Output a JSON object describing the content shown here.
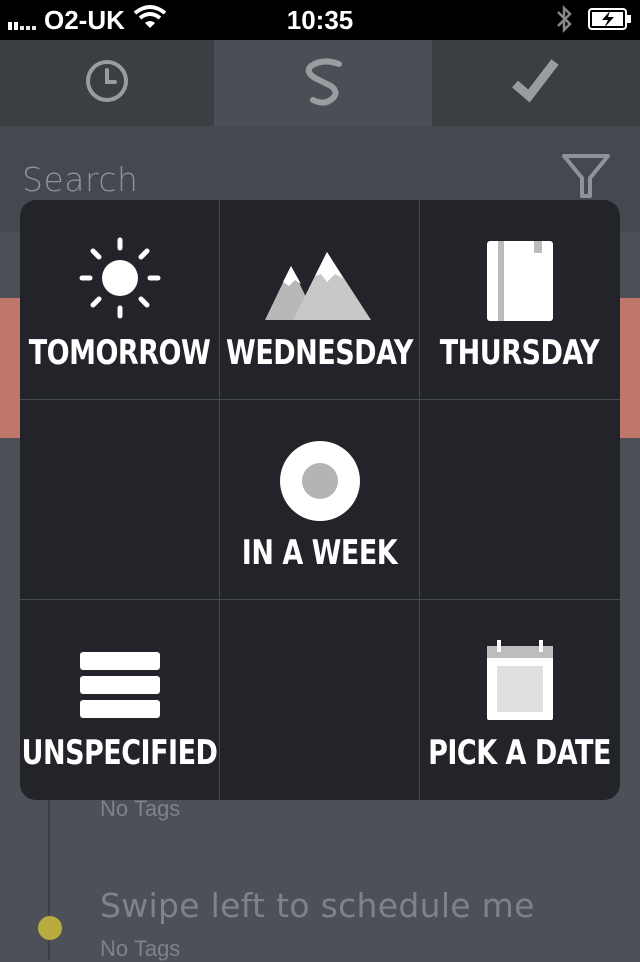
{
  "status_bar": {
    "carrier": "O2-UK",
    "time": "10:35",
    "signal_icon": "signal-bars-icon",
    "wifi_icon": "wifi-icon",
    "bluetooth_icon": "bluetooth-icon",
    "battery_icon": "battery-charging-icon"
  },
  "tabs": [
    {
      "icon": "clock-icon",
      "selected": false
    },
    {
      "icon": "swipe-s-icon",
      "selected": true
    },
    {
      "icon": "checkmark-icon",
      "selected": false
    }
  ],
  "search": {
    "placeholder": "Search",
    "filter_icon": "filter-icon"
  },
  "list": {
    "items": [
      {
        "title": "",
        "tags": "No Tags"
      },
      {
        "title": "Swipe left to schedule me",
        "tags": "No Tags"
      }
    ]
  },
  "schedule_popup": {
    "options": [
      {
        "label": "Tomorrow",
        "icon": "sun-icon"
      },
      {
        "label": "Wednesday",
        "icon": "mountains-icon"
      },
      {
        "label": "Thursday",
        "icon": "notebook-icon"
      },
      {
        "label": "In a week",
        "icon": "circle-dot-icon"
      },
      {
        "label": "Unspecified",
        "icon": "list-bars-icon"
      },
      {
        "label": "Pick a date",
        "icon": "calendar-icon"
      }
    ]
  },
  "colors": {
    "accent_row": "#c1766a",
    "dot": "#b9aa3f",
    "popup_bg": "#22242a"
  }
}
